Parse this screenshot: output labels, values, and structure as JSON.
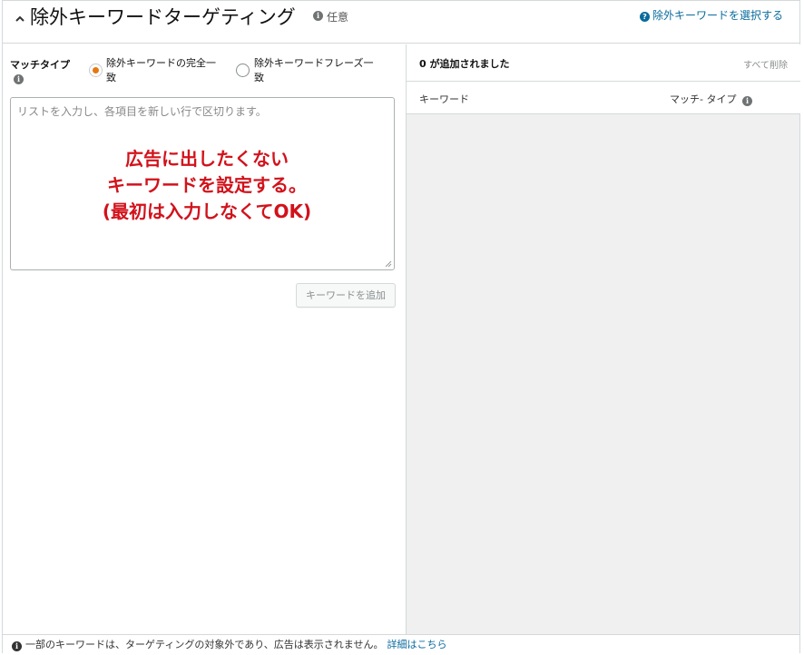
{
  "header": {
    "title": "除外キーワードターゲティング",
    "optional": "任意",
    "select_link": "除外キーワードを選択する"
  },
  "left": {
    "match_type_label": "マッチタイプ",
    "radio_exact": {
      "line1": "除外キーワードの完全一",
      "line2": "致",
      "checked": true
    },
    "radio_phrase": {
      "line1": "除外キーワードフレーズ一",
      "line2": "致",
      "checked": false
    },
    "textarea_placeholder": "リストを入力し、各項目を新しい行で区切ります。",
    "annotation": [
      "広告に出したくない",
      "キーワードを設定する。",
      "(最初は入力しなくてOK)"
    ],
    "add_button": "キーワードを追加"
  },
  "right": {
    "added_count": "0 が追加されました",
    "remove_all": "すべて削除",
    "col_keyword": "キーワード",
    "col_match_type": "マッチ- タイプ"
  },
  "footer": {
    "notice": "一部のキーワードは、ターゲティングの対象外であり、広告は表示されません。",
    "link": "詳細はこちら"
  },
  "colors": {
    "accent_orange": "#e47911",
    "link_blue": "#0a6b9e",
    "annotation_red": "#d2121b"
  }
}
